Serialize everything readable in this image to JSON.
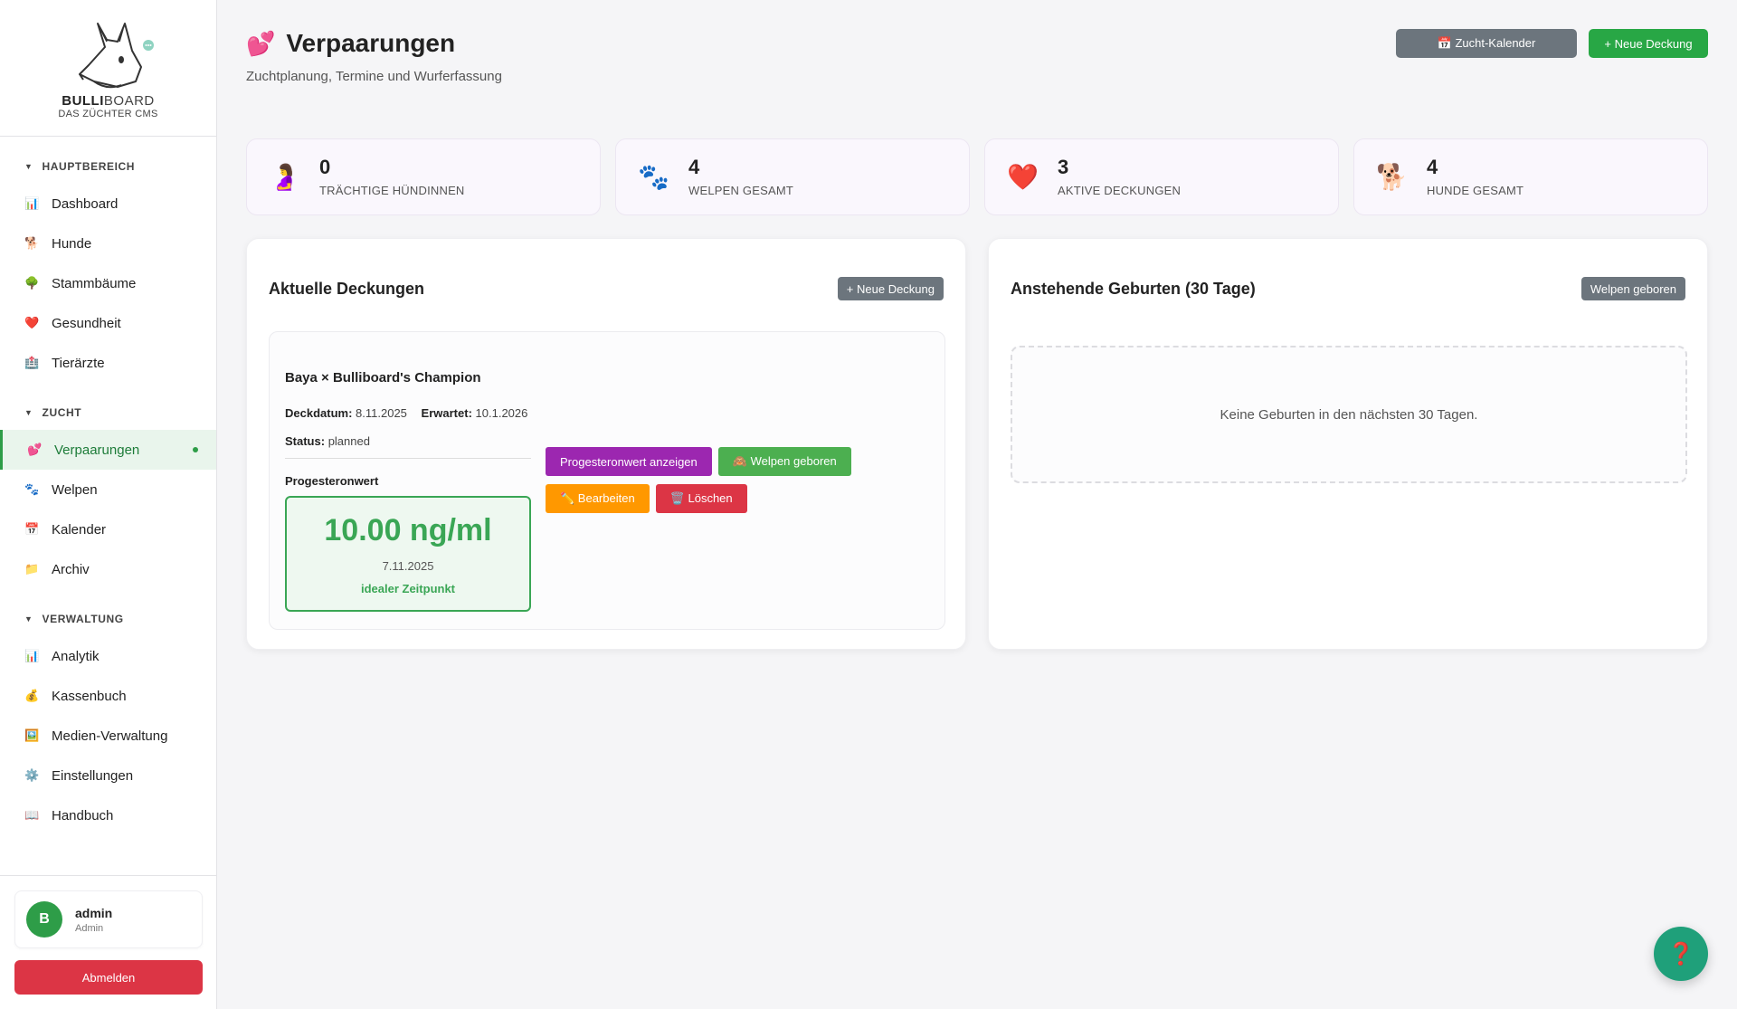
{
  "brand": {
    "name_bold": "BULLI",
    "name_light": "BOARD",
    "subtitle": "DAS ZÜCHTER CMS"
  },
  "sidebar": {
    "sections": [
      {
        "heading": "HAUPTBEREICH",
        "items": [
          {
            "label": "Dashboard",
            "icon": "📊"
          },
          {
            "label": "Hunde",
            "icon": "🐕"
          },
          {
            "label": "Stammbäume",
            "icon": "🌳"
          },
          {
            "label": "Gesundheit",
            "icon": "❤️"
          },
          {
            "label": "Tierärzte",
            "icon": "🏥"
          }
        ]
      },
      {
        "heading": "ZUCHT",
        "items": [
          {
            "label": "Verpaarungen",
            "icon": "💕",
            "active": true
          },
          {
            "label": "Welpen",
            "icon": "🐾"
          },
          {
            "label": "Kalender",
            "icon": "📅"
          },
          {
            "label": "Archiv",
            "icon": "📁"
          }
        ]
      },
      {
        "heading": "VERWALTUNG",
        "items": [
          {
            "label": "Analytik",
            "icon": "📊"
          },
          {
            "label": "Kassenbuch",
            "icon": "💰"
          },
          {
            "label": "Medien-Verwaltung",
            "icon": "🖼️"
          },
          {
            "label": "Einstellungen",
            "icon": "⚙️"
          },
          {
            "label": "Handbuch",
            "icon": "📖"
          }
        ]
      }
    ],
    "user": {
      "initial": "B",
      "name": "admin",
      "role": "Admin"
    },
    "logout_label": "Abmelden"
  },
  "header": {
    "icon": "💕",
    "title": "Verpaarungen",
    "subtitle": "Zuchtplanung, Termine und Wurferfassung",
    "calendar_btn": "📅 Zucht-Kalender",
    "new_btn": "+ Neue Deckung"
  },
  "stats": [
    {
      "icon": "🤰",
      "value": "0",
      "label": "TRÄCHTIGE HÜNDINNEN"
    },
    {
      "icon": "🐾",
      "value": "4",
      "label": "WELPEN GESAMT"
    },
    {
      "icon": "❤️",
      "value": "3",
      "label": "AKTIVE DECKUNGEN"
    },
    {
      "icon": "🐕",
      "value": "4",
      "label": "HUNDE GESAMT"
    }
  ],
  "current": {
    "title": "Aktuelle Deckungen",
    "new_btn": "+ Neue Deckung",
    "mating": {
      "title": "Baya × Bulliboard's Champion",
      "deck_label": "Deckdatum:",
      "deck_value": "8.11.2025",
      "exp_label": "Erwartet:",
      "exp_value": "10.1.2026",
      "status_label": "Status:",
      "status_value": "planned",
      "prog_label": "Progesteronwert",
      "prog_value": "10.00 ng/ml",
      "prog_date": "7.11.2025",
      "prog_note": "idealer Zeitpunkt",
      "actions": {
        "show_prog": "Progesteronwert anzeigen",
        "born": "🙈 Welpen geboren",
        "edit": "✏️ Bearbeiten",
        "delete": "🗑️ Löschen"
      }
    }
  },
  "upcoming": {
    "title": "Anstehende Geburten (30 Tage)",
    "born_btn": "Welpen geboren",
    "empty": "Keine Geburten in den nächsten 30 Tagen."
  },
  "help_icon": "❓"
}
